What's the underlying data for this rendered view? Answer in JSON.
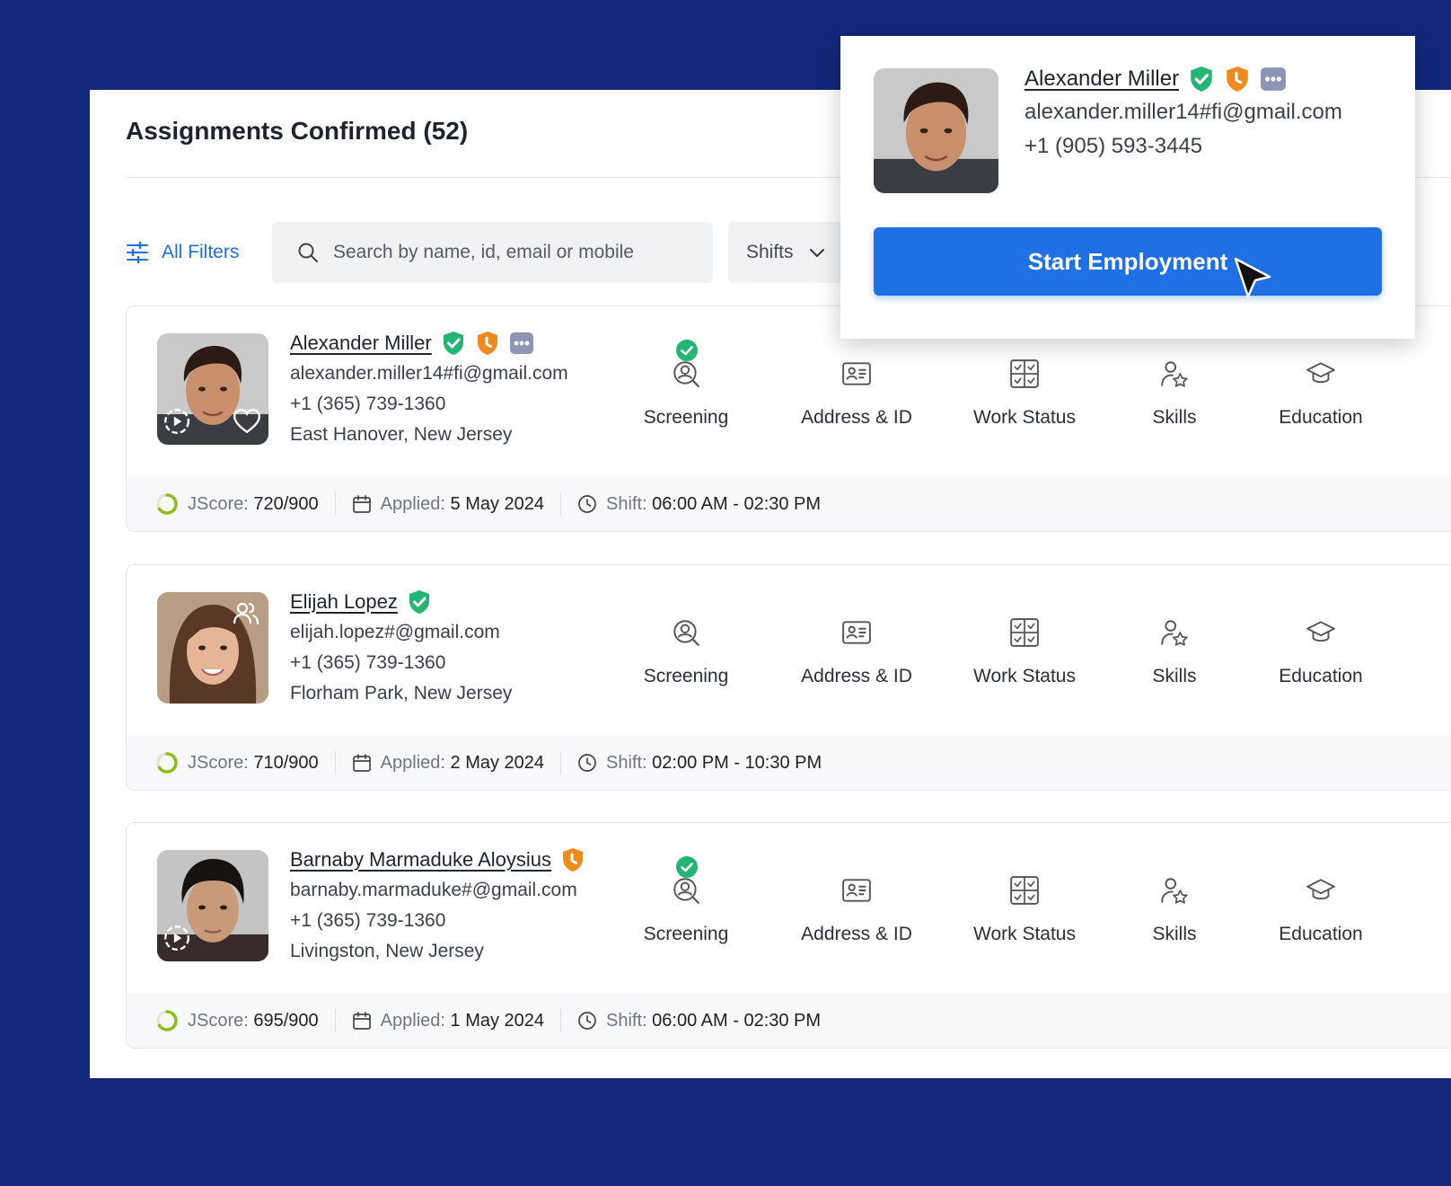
{
  "page": {
    "title": "Assignments Confirmed (52)"
  },
  "toolbar": {
    "all_filters": "All Filters",
    "search_placeholder": "Search by name, id, email or mobile",
    "shifts": "Shifts"
  },
  "steps": [
    "Screening",
    "Address & ID",
    "Work Status",
    "Skills",
    "Education"
  ],
  "labels": {
    "jscore": "JScore:",
    "applied": "Applied:",
    "shift": "Shift:"
  },
  "candidates": [
    {
      "name": "Alexander Miller",
      "email": "alexander.miller14#fi@gmail.com",
      "phone": "+1 (365) 739-1360",
      "location": "East Hanover, New Jersey",
      "jscore": "720/900",
      "applied": "5 May 2024",
      "shift": "06:00 AM - 02:30 PM"
    },
    {
      "name": "Elijah Lopez",
      "email": "elijah.lopez#@gmail.com",
      "phone": "+1 (365) 739-1360",
      "location": "Florham Park, New Jersey",
      "jscore": "710/900",
      "applied": "2 May 2024",
      "shift": "02:00 PM - 10:30 PM"
    },
    {
      "name": "Barnaby Marmaduke Aloysius",
      "email": "barnaby.marmaduke#@gmail.com",
      "phone": "+1 (365) 739-1360",
      "location": "Livingston, New Jersey",
      "jscore": "695/900",
      "applied": "1 May 2024",
      "shift": "06:00 AM - 02:30 PM"
    }
  ],
  "popup": {
    "name": "Alexander Miller",
    "email": "alexander.miller14#fi@gmail.com",
    "phone": "+1 (905) 593-3445",
    "button": "Start Employment"
  },
  "colors": {
    "background": "#11287a",
    "accent": "#1f6fe5",
    "verified_green": "#22b573",
    "badge_orange": "#ef8a1f",
    "badge_grey": "#8d95b5"
  }
}
